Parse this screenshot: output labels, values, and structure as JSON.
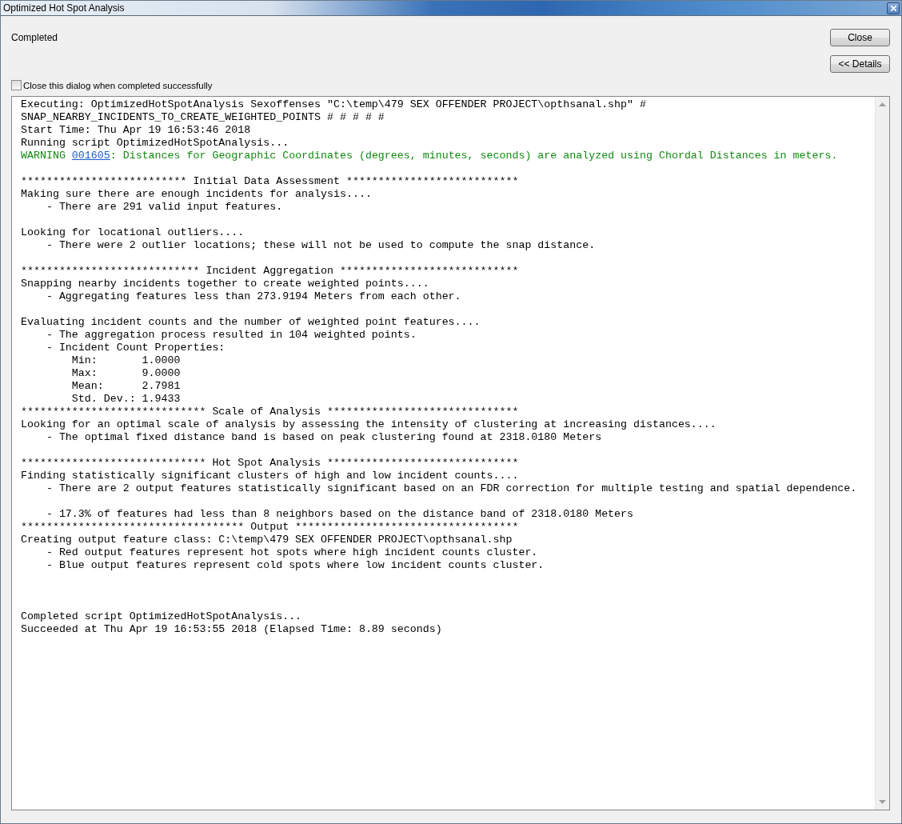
{
  "window": {
    "title": "Optimized Hot Spot Analysis"
  },
  "status": "Completed",
  "buttons": [
    {
      "label": "Close"
    },
    {
      "label": "<< Details"
    }
  ],
  "close_when_done": {
    "label": "Close this dialog when completed successfully",
    "checked": false
  },
  "log": [
    {
      "kind": "normal",
      "text": "Executing: OptimizedHotSpotAnalysis Sexoffenses \"C:\\temp\\479 SEX OFFENDER PROJECT\\opthsanal.shp\" #"
    },
    {
      "kind": "normal",
      "text": "SNAP_NEARBY_INCIDENTS_TO_CREATE_WEIGHTED_POINTS # # # # #"
    },
    {
      "kind": "normal",
      "text": "Start Time: Thu Apr 19 16:53:46 2018"
    },
    {
      "kind": "normal",
      "text": "Running script OptimizedHotSpotAnalysis..."
    },
    {
      "kind": "warning",
      "prefix": "WARNING ",
      "link": "001605",
      "text": ": Distances for Geographic Coordinates (degrees, minutes, seconds) are analyzed using Chordal Distances in meters."
    },
    {
      "kind": "blank"
    },
    {
      "kind": "normal",
      "text": "************************** Initial Data Assessment ***************************"
    },
    {
      "kind": "normal",
      "text": "Making sure there are enough incidents for analysis...."
    },
    {
      "kind": "normal",
      "text": "    - There are 291 valid input features."
    },
    {
      "kind": "blank"
    },
    {
      "kind": "normal",
      "text": "Looking for locational outliers...."
    },
    {
      "kind": "normal",
      "text": "    - There were 2 outlier locations; these will not be used to compute the snap distance."
    },
    {
      "kind": "blank"
    },
    {
      "kind": "normal",
      "text": "**************************** Incident Aggregation ****************************"
    },
    {
      "kind": "normal",
      "text": "Snapping nearby incidents together to create weighted points...."
    },
    {
      "kind": "normal",
      "text": "    - Aggregating features less than 273.9194 Meters from each other."
    },
    {
      "kind": "blank"
    },
    {
      "kind": "normal",
      "text": "Evaluating incident counts and the number of weighted point features...."
    },
    {
      "kind": "normal",
      "text": "    - The aggregation process resulted in 104 weighted points."
    },
    {
      "kind": "normal",
      "text": "    - Incident Count Properties:"
    },
    {
      "kind": "normal",
      "text": "        Min:       1.0000"
    },
    {
      "kind": "normal",
      "text": "        Max:       9.0000"
    },
    {
      "kind": "normal",
      "text": "        Mean:      2.7981"
    },
    {
      "kind": "normal",
      "text": "        Std. Dev.: 1.9433"
    },
    {
      "kind": "normal",
      "text": "***************************** Scale of Analysis ******************************"
    },
    {
      "kind": "normal",
      "text": "Looking for an optimal scale of analysis by assessing the intensity of clustering at increasing distances...."
    },
    {
      "kind": "normal",
      "text": "    - The optimal fixed distance band is based on peak clustering found at 2318.0180 Meters"
    },
    {
      "kind": "blank"
    },
    {
      "kind": "normal",
      "text": "***************************** Hot Spot Analysis ******************************"
    },
    {
      "kind": "normal",
      "text": "Finding statistically significant clusters of high and low incident counts...."
    },
    {
      "kind": "normal",
      "text": "    - There are 2 output features statistically significant based on an FDR correction for multiple testing and spatial dependence."
    },
    {
      "kind": "blank"
    },
    {
      "kind": "normal",
      "text": "    - 17.3% of features had less than 8 neighbors based on the distance band of 2318.0180 Meters"
    },
    {
      "kind": "normal",
      "text": "*********************************** Output ***********************************"
    },
    {
      "kind": "normal",
      "text": "Creating output feature class: C:\\temp\\479 SEX OFFENDER PROJECT\\opthsanal.shp"
    },
    {
      "kind": "normal",
      "text": "    - Red output features represent hot spots where high incident counts cluster."
    },
    {
      "kind": "normal",
      "text": "    - Blue output features represent cold spots where low incident counts cluster."
    },
    {
      "kind": "blank"
    },
    {
      "kind": "blank"
    },
    {
      "kind": "blank"
    },
    {
      "kind": "normal",
      "text": "Completed script OptimizedHotSpotAnalysis..."
    },
    {
      "kind": "normal",
      "text": "Succeeded at Thu Apr 19 16:53:55 2018 (Elapsed Time: 8.89 seconds)"
    }
  ]
}
